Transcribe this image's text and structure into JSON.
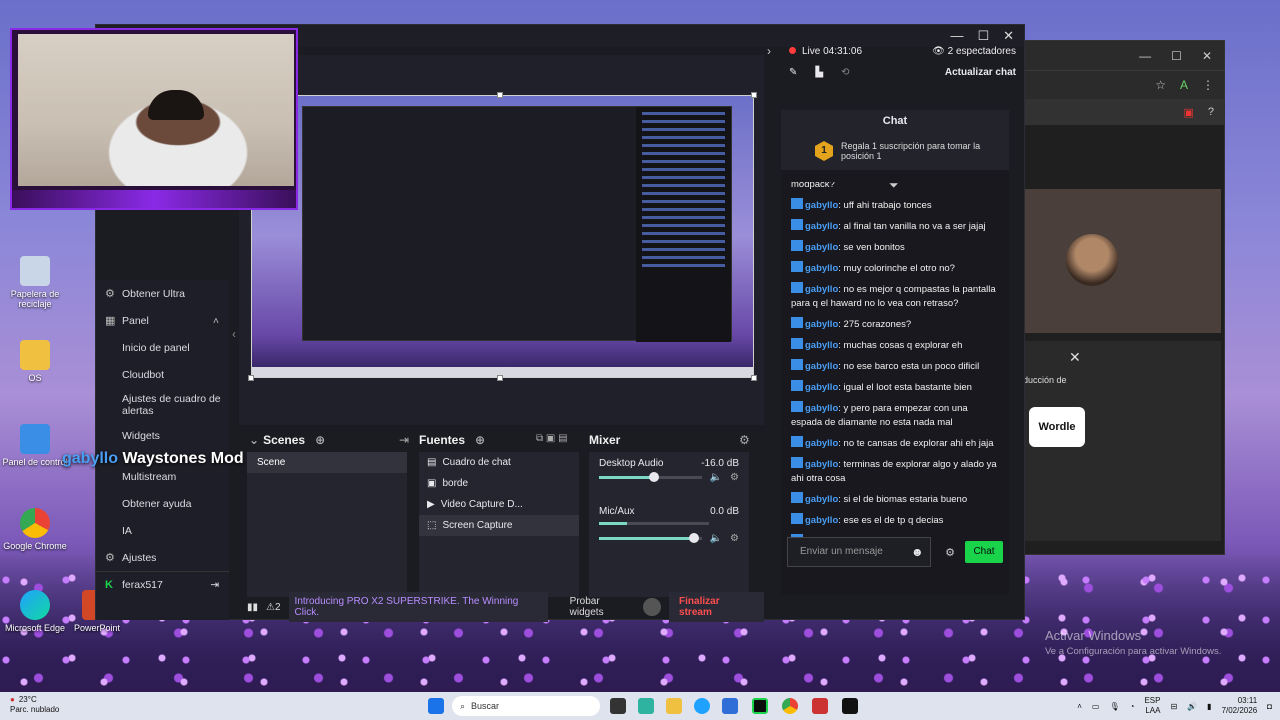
{
  "desktop": {
    "icons": [
      {
        "label": "Papelera de reciclaje"
      },
      {
        "label": "OS"
      },
      {
        "label": "Panel de control"
      },
      {
        "label": "Google Chrome"
      },
      {
        "label": "Microsoft Edge"
      },
      {
        "label": "PowerPoint"
      }
    ],
    "activate": {
      "title": "Activar Windows",
      "subtitle": "Ve a Configuración para activar Windows."
    }
  },
  "browser": {
    "popup_text": "ducción de",
    "wordle": "Wordle"
  },
  "obs": {
    "sidebar": {
      "items": [
        {
          "label": "Obtener Ultra"
        },
        {
          "label": "Panel"
        },
        {
          "label": "Inicio de panel"
        },
        {
          "label": "Cloudbot"
        },
        {
          "label": "Ajustes de cuadro de alertas"
        },
        {
          "label": "Widgets"
        },
        {
          "label": "Multistream"
        },
        {
          "label": "Obtener ayuda"
        },
        {
          "label": "IA"
        },
        {
          "label": "Ajustes"
        }
      ],
      "user": "ferax517"
    },
    "docks": {
      "scenes_title": "Scenes",
      "scene_item": "Scene",
      "sources_title": "Fuentes",
      "sources": [
        {
          "label": "Cuadro de chat"
        },
        {
          "label": "borde"
        },
        {
          "label": "Video Capture D..."
        },
        {
          "label": "Screen Capture"
        }
      ],
      "mixer_title": "Mixer",
      "mixer": [
        {
          "name": "Desktop Audio",
          "level": "-16.0 dB"
        },
        {
          "name": "Mic/Aux",
          "level": "0.0 dB"
        }
      ]
    },
    "statusbar": {
      "alerts": "2",
      "ticker": "Introducing PRO X2 SUPERSTRIKE. The Winning Click.",
      "test_widgets": "Probar widgets",
      "end_stream": "Finalizar stream"
    }
  },
  "chat": {
    "live": "Live 04:31:06",
    "viewers": "2 espectadores",
    "refresh": "Actualizar chat",
    "title": "Chat",
    "gift_text": "Regala 1 suscripción para tomar la posición 1",
    "gift_rank": "1",
    "partial_top": "modpack?",
    "messages": [
      {
        "user": "gabyllo",
        "text": ": uff ahi trabajo tonces"
      },
      {
        "user": "gabyllo",
        "text": ": al final tan vanilla no va a ser jajaj"
      },
      {
        "user": "gabyllo",
        "text": ": se ven bonitos"
      },
      {
        "user": "gabyllo",
        "text": ": muy colorinche el otro no?"
      },
      {
        "user": "gabyllo",
        "text": ": no es mejor q compastas la pantalla para q el haward no lo vea con retraso?"
      },
      {
        "user": "gabyllo",
        "text": ": 275 corazones?"
      },
      {
        "user": "gabyllo",
        "text": ": muchas cosas q explorar eh"
      },
      {
        "user": "gabyllo",
        "text": ": no ese barco esta un poco dificil"
      },
      {
        "user": "gabyllo",
        "text": ": igual el loot esta bastante bien"
      },
      {
        "user": "gabyllo",
        "text": ": y pero para empezar con una espada de diamante no esta nada mal"
      },
      {
        "user": "gabyllo",
        "text": ": no te cansas de explorar ahi eh jaja"
      },
      {
        "user": "gabyllo",
        "text": ": terminas de explorar algo y alado ya ahi otra cosa"
      },
      {
        "user": "gabyllo",
        "text": ": si el de biomas estaria bueno"
      },
      {
        "user": "gabyllo",
        "text": ": ese es el de tp q decias"
      },
      {
        "user": "gabyllo",
        "text": ": Waystones Mod"
      }
    ],
    "input_placeholder": "Enviar un mensaje",
    "send_label": "Chat"
  },
  "overlay": {
    "user": "gabyllo",
    "message": "Waystones Mod"
  },
  "taskbar": {
    "temp": "23°C",
    "weather": "Parc. nublado",
    "search": "Buscar",
    "lang1": "ESP",
    "lang2": "LAA",
    "time": "03:11",
    "date": "7/02/2026"
  }
}
